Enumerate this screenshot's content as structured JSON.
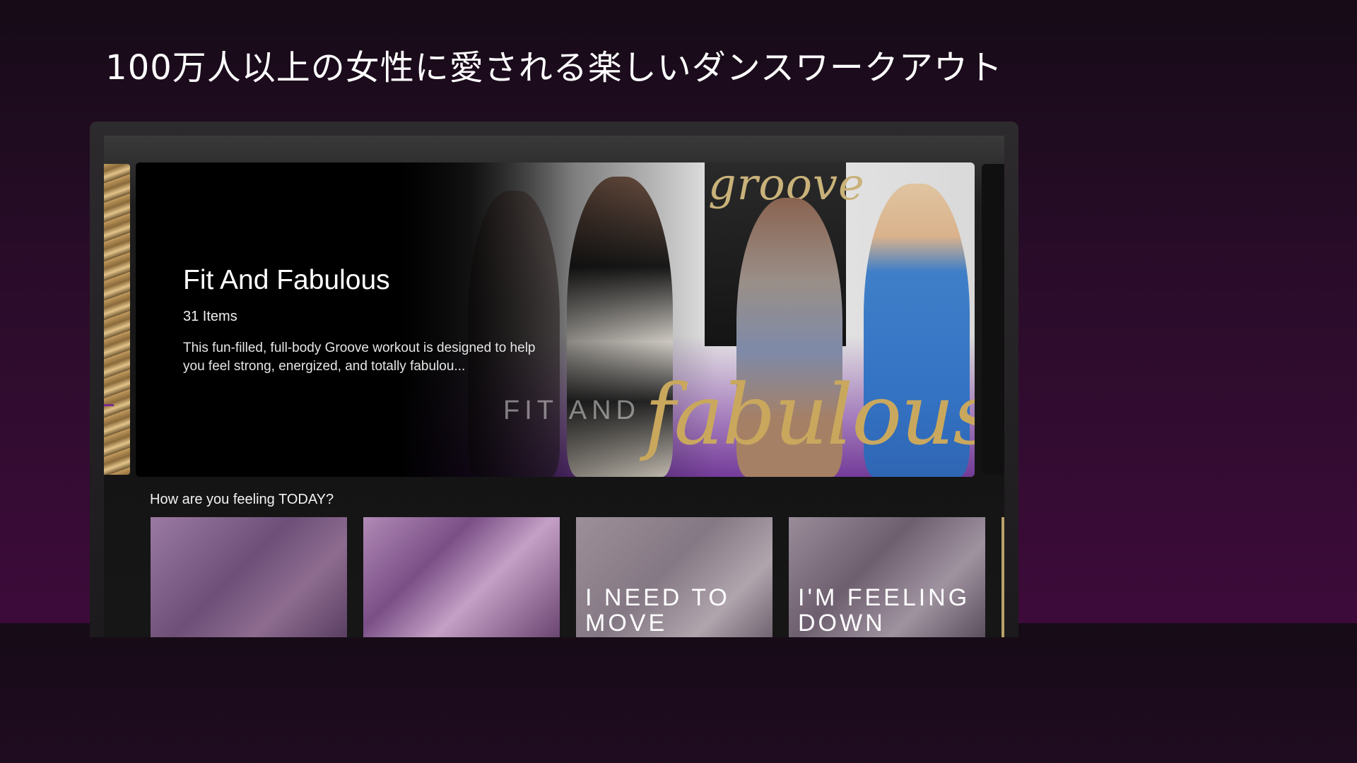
{
  "headline": "100万人以上の女性に愛される楽しいダンスワークアウト",
  "hero": {
    "title": "Fit And Fabulous",
    "count": "31 Items",
    "description": "This fun-filled, full-body Groove workout is designed to help you feel strong, energized, and totally fabulou...",
    "art_word_1": "FIT AND",
    "art_word_2": "fabulous",
    "art_logo": "groove"
  },
  "row": {
    "title": "How are you feeling TODAY?",
    "tiles": [
      {
        "label": ""
      },
      {
        "label": ""
      },
      {
        "label": "I NEED TO\nMOVE"
      },
      {
        "label": "I'M FEELING\nDOWN"
      }
    ]
  },
  "colors": {
    "background_top": "#160b17",
    "background_bottom": "#3d0b3a",
    "accent_gold": "#c9a85e",
    "accent_purple": "#5f1e8c"
  }
}
